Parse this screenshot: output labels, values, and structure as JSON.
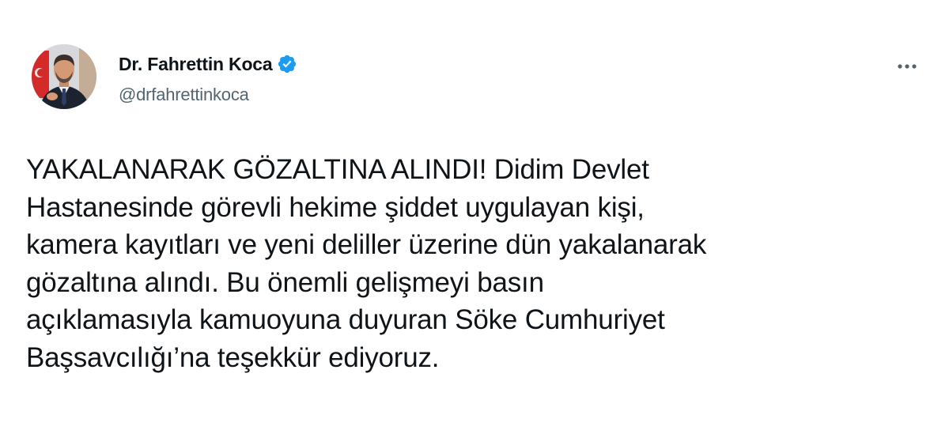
{
  "author": {
    "display_name": "Dr. Fahrettin Koca",
    "handle": "@drfahrettinkoca",
    "verified": true,
    "verified_icon": "verified-badge-icon",
    "avatar_icon": "profile-photo"
  },
  "tweet": {
    "text": "YAKALANARAK GÖZALTINA ALINDI! Didim Devlet\nHastanesinde görevli hekime şiddet uygulayan kişi,\nkamera kayıtları ve yeni deliller üzerine dün yakalanarak\ngözaltına alındı. Bu önemli gelişmeyi basın\naçıklamasıyla kamuoyuna duyuran Söke Cumhuriyet\nBaşsavcılığı’na teşekkür ediyoruz."
  },
  "menu": {
    "icon": "more-options-icon"
  },
  "colors": {
    "text_primary": "#0f1419",
    "text_secondary": "#536471",
    "verified_blue": "#1d9bf0",
    "background": "#ffffff"
  }
}
